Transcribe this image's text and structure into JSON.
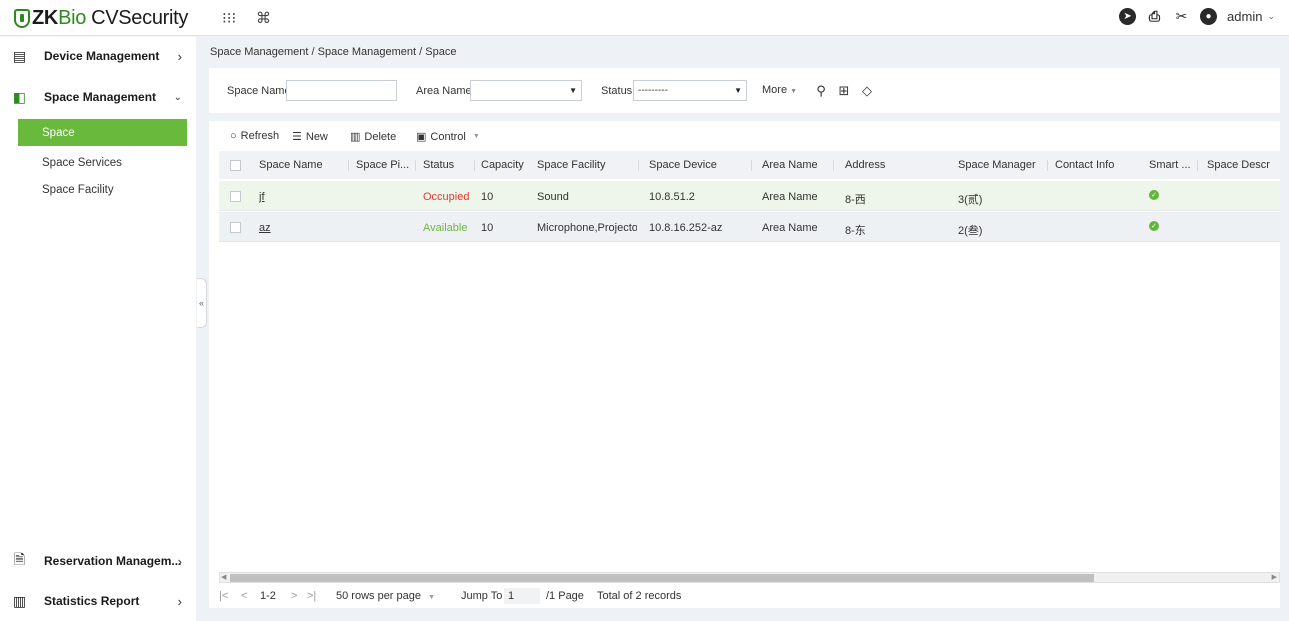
{
  "header": {
    "logo_zk": "ZK",
    "logo_bio": "Bio",
    "logo_cvs": "CVSecurity",
    "user": "admin"
  },
  "sidebar": {
    "groups": [
      {
        "label": "Device Management",
        "icon": "device-icon",
        "expanded": false
      },
      {
        "label": "Space Management",
        "icon": "space-icon",
        "expanded": true
      },
      {
        "label": "Reservation Managem...",
        "icon": "reservation-icon",
        "expanded": false
      },
      {
        "label": "Statistics Report",
        "icon": "statistics-icon",
        "expanded": false
      }
    ],
    "subitems": [
      "Space",
      "Space Services",
      "Space Facility"
    ],
    "active": "Space"
  },
  "breadcrumb": "Space Management / Space Management / Space",
  "filter": {
    "space_name_label": "Space Name",
    "space_name_value": "",
    "area_name_label": "Area Name",
    "area_name_value": "",
    "status_label": "Status",
    "status_value": "---------",
    "more_label": "More"
  },
  "toolbar": {
    "refresh": "Refresh",
    "new": "New",
    "delete": "Delete",
    "control": "Control"
  },
  "table": {
    "columns": [
      "Space Name",
      "Space Pi...",
      "Status",
      "Capacity",
      "Space Facility",
      "Space Device",
      "Area Name",
      "Address",
      "Space Manager",
      "Contact Info",
      "Smart ...",
      "Space Descr"
    ],
    "rows": [
      {
        "space_name": "jf",
        "space_pic": "",
        "status": "Occupied",
        "capacity": "10",
        "facility": "Sound",
        "device": "10.8.51.2",
        "area": "Area Name",
        "address": "8-西",
        "manager": "3(贰)",
        "contact": "",
        "smart": true,
        "desc": ""
      },
      {
        "space_name": "az",
        "space_pic": "",
        "status": "Available",
        "capacity": "10",
        "facility": "Microphone,Projecto",
        "device": "10.8.16.252-az",
        "area": "Area Name",
        "address": "8-东",
        "manager": "2(叁)",
        "contact": "",
        "smart": true,
        "desc": ""
      }
    ]
  },
  "pagination": {
    "range": "1-2",
    "rows_per_page": "50 rows per page",
    "jump_to": "Jump To",
    "page_value": "1",
    "page_total": "/1 Page",
    "total": "Total of 2 records"
  },
  "colors": {
    "brand_green": "#2d8a1f",
    "active_green": "#69b93d",
    "occupied_red": "#e33b2e",
    "available_green": "#6cb641"
  }
}
